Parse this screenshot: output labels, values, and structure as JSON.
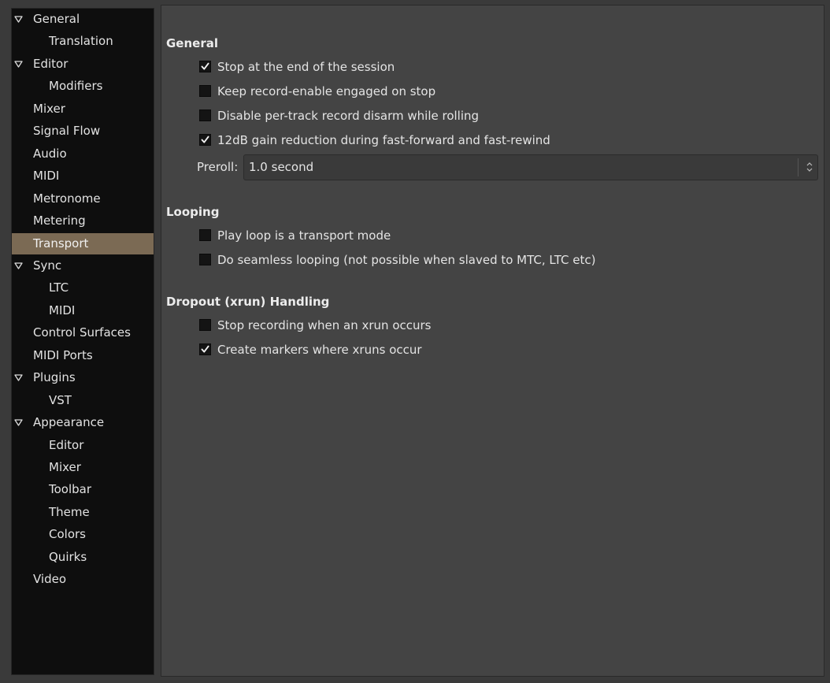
{
  "sidebar": {
    "items": [
      {
        "label": "General",
        "level": 0,
        "expanded": true
      },
      {
        "label": "Translation",
        "level": 1
      },
      {
        "label": "Editor",
        "level": 0,
        "expanded": true
      },
      {
        "label": "Modifiers",
        "level": 1
      },
      {
        "label": "Mixer",
        "level": 0
      },
      {
        "label": "Signal Flow",
        "level": 0
      },
      {
        "label": "Audio",
        "level": 0
      },
      {
        "label": "MIDI",
        "level": 0
      },
      {
        "label": "Metronome",
        "level": 0
      },
      {
        "label": "Metering",
        "level": 0
      },
      {
        "label": "Transport",
        "level": 0,
        "selected": true
      },
      {
        "label": "Sync",
        "level": 0,
        "expanded": true
      },
      {
        "label": "LTC",
        "level": 1
      },
      {
        "label": "MIDI",
        "level": 1
      },
      {
        "label": "Control Surfaces",
        "level": 0
      },
      {
        "label": "MIDI Ports",
        "level": 0
      },
      {
        "label": "Plugins",
        "level": 0,
        "expanded": true
      },
      {
        "label": "VST",
        "level": 1
      },
      {
        "label": "Appearance",
        "level": 0,
        "expanded": true
      },
      {
        "label": "Editor",
        "level": 1
      },
      {
        "label": "Mixer",
        "level": 1
      },
      {
        "label": "Toolbar",
        "level": 1
      },
      {
        "label": "Theme",
        "level": 1
      },
      {
        "label": "Colors",
        "level": 1
      },
      {
        "label": "Quirks",
        "level": 1
      },
      {
        "label": "Video",
        "level": 0
      }
    ]
  },
  "main": {
    "general": {
      "title": "General",
      "options": [
        {
          "label": "Stop at the end of the session",
          "checked": true
        },
        {
          "label": "Keep record-enable engaged on stop",
          "checked": false
        },
        {
          "label": "Disable per-track record disarm while rolling",
          "checked": false
        },
        {
          "label": "12dB gain reduction during fast-forward and fast-rewind",
          "checked": true
        }
      ],
      "preroll_label": "Preroll:",
      "preroll_value": "1.0 second"
    },
    "looping": {
      "title": "Looping",
      "options": [
        {
          "label": "Play loop is a transport mode",
          "checked": false
        },
        {
          "label": "Do seamless looping (not possible when slaved to MTC, LTC etc)",
          "checked": false
        }
      ]
    },
    "dropout": {
      "title": "Dropout (xrun) Handling",
      "options": [
        {
          "label": "Stop recording when an xrun occurs",
          "checked": false
        },
        {
          "label": "Create markers where xruns occur",
          "checked": true
        }
      ]
    }
  },
  "colors": {
    "selected_bg": "#7b6a54",
    "sidebar_bg": "#0e0e0e",
    "panel_bg": "#444444"
  }
}
